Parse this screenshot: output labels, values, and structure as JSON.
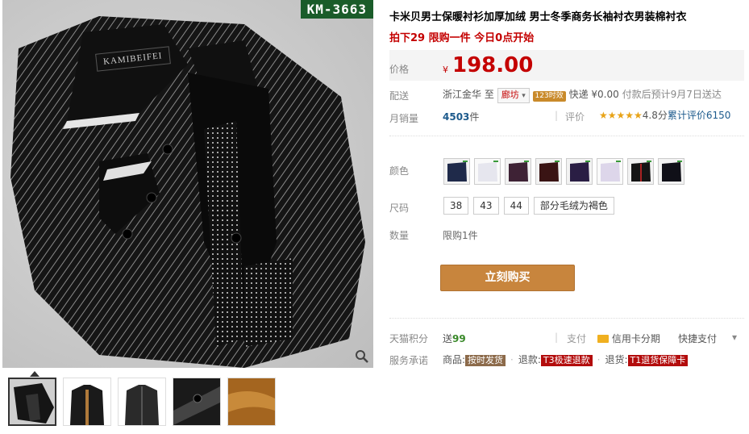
{
  "gallery": {
    "code_label": "KM-3663",
    "brand_tag": "KAMIBEIFEI",
    "zoom_icon": "magnifier-icon",
    "thumbnails": [
      {
        "name": "thumb-front",
        "active": true
      },
      {
        "name": "thumb-model-a"
      },
      {
        "name": "thumb-model-b"
      },
      {
        "name": "thumb-detail"
      },
      {
        "name": "thumb-fleece"
      }
    ]
  },
  "product": {
    "title": "卡米贝男士保暖衬衫加厚加绒 男士冬季商务长袖衬衣男装棉衬衣",
    "promo": "拍下29 限购一件 今日0点开始",
    "price_label": "价格",
    "currency": "¥",
    "price": "198.00",
    "shipping_label": "配送",
    "ship_from": "浙江金华",
    "ship_to_word": "至",
    "ship_to": "廊坊",
    "time_badge": "123时效",
    "express": "快递 ¥0.00",
    "delivery_note": "付款后预计9月7日送达",
    "monthly_sales_label": "月销量",
    "monthly_sales_value": "4503",
    "monthly_sales_unit": "件",
    "review_label": "评价",
    "rating_stars": "★★★★★",
    "rating_text": "4.8分",
    "review_count_text": "累计评价6150",
    "color_label": "颜色",
    "size_label": "尺码",
    "sizes": [
      "38",
      "43",
      "44",
      "部分毛绒为褐色"
    ],
    "quantity_label": "数量",
    "quantity_note": "限购1件",
    "buy_button": "立刻购买",
    "points_label": "天猫积分",
    "points_prefix": "送",
    "points_value": "99",
    "pay_label": "支付",
    "credit_card": "信用卡分期",
    "quick_pay": "快捷支付",
    "service_label": "服务承诺",
    "svc_goods": "商品:",
    "svc_goods_tag": "按时发货",
    "svc_refund": "退款:",
    "svc_refund_tag": "T3极速退款",
    "svc_return": "退货:",
    "svc_return_tag": "T1退货保障卡"
  },
  "colors": {
    "accent_red": "#c40000",
    "buy_button": "#c8853d",
    "code_label_bg": "#1a5c2a"
  }
}
